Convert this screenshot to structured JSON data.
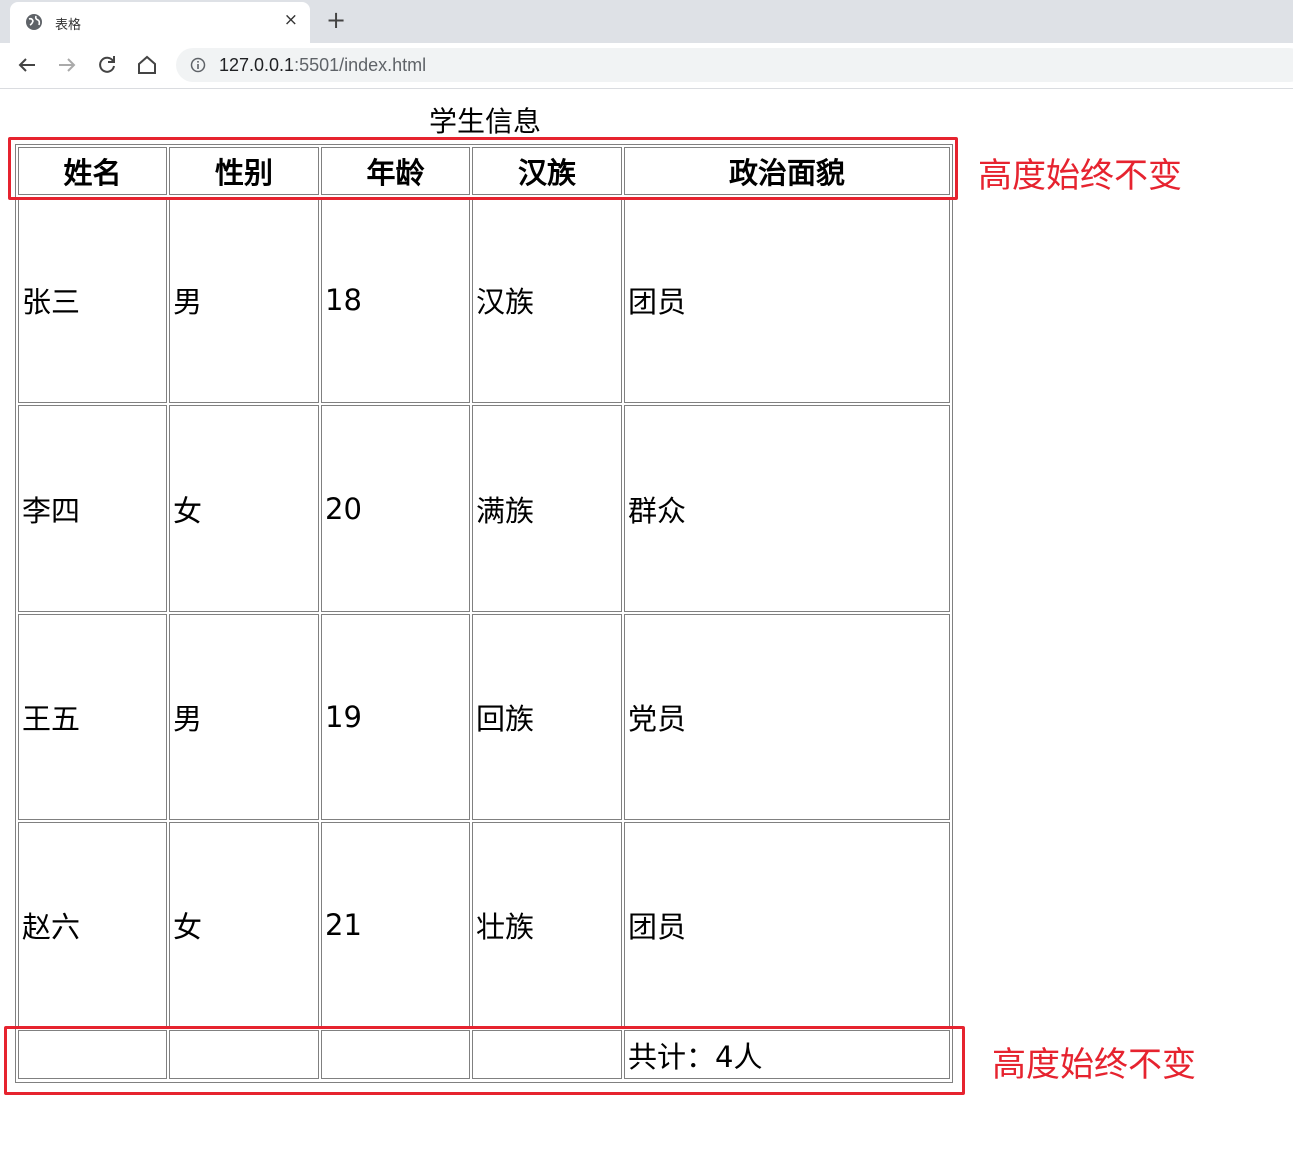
{
  "browser": {
    "tab_title": "表格",
    "close_glyph": "×",
    "new_tab_glyph": "+",
    "url_host": "127.0.0.1",
    "url_rest": ":5501/index.html",
    "icons": [
      "back-arrow-icon",
      "forward-arrow-icon",
      "reload-icon",
      "home-icon",
      "info-icon",
      "globe-icon"
    ]
  },
  "table": {
    "caption": "学生信息",
    "headers": [
      "姓名",
      "性别",
      "年龄",
      "汉族",
      "政治面貌"
    ],
    "rows": [
      [
        "张三",
        "男",
        "18",
        "汉族",
        "团员"
      ],
      [
        "李四",
        "女",
        "20",
        "满族",
        "群众"
      ],
      [
        "王五",
        "男",
        "19",
        "回族",
        "党员"
      ],
      [
        "赵六",
        "女",
        "21",
        "壮族",
        "团员"
      ]
    ],
    "footer": [
      "",
      "",
      "",
      "",
      "共计：4人"
    ]
  },
  "annotations": {
    "header_note": "高度始终不变",
    "footer_note": "高度始终不变",
    "color": "#e6232f"
  }
}
